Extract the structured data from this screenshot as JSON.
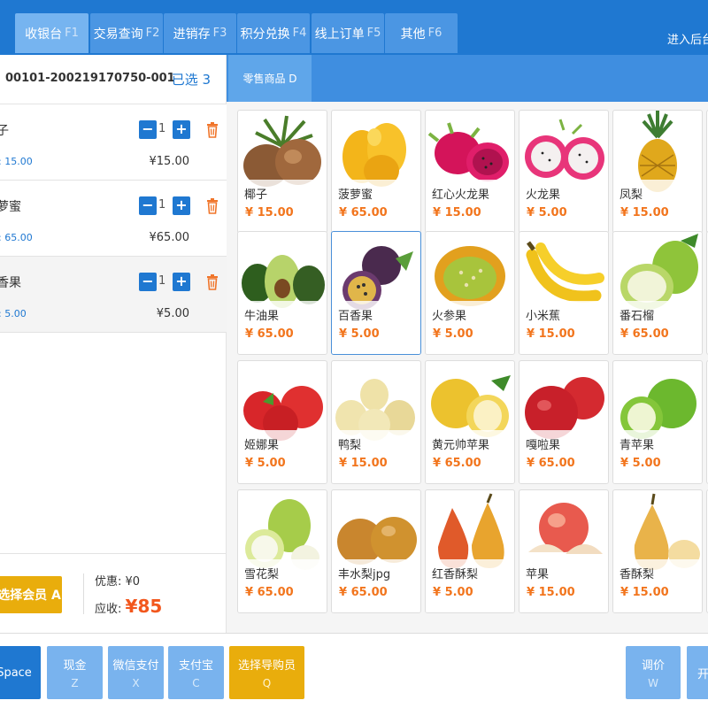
{
  "colors": {
    "primary": "#1f78d1",
    "accent_orange": "#f2571d",
    "yellow_button": "#e9ad0c"
  },
  "nav": {
    "tabs": [
      {
        "label": "收银台",
        "key": "F1"
      },
      {
        "label": "交易查询",
        "key": "F2"
      },
      {
        "label": "进销存",
        "key": "F3"
      },
      {
        "label": "积分兑换",
        "key": "F4"
      },
      {
        "label": "线上订单",
        "key": "F5"
      },
      {
        "label": "其他",
        "key": "F6"
      }
    ],
    "enter_back": "进入后台"
  },
  "order": {
    "number": "00101-200219170750-001",
    "selected": "已选 3",
    "items": [
      {
        "name": "子",
        "unit_price": ": 15.00",
        "qty": "1",
        "total": "¥15.00"
      },
      {
        "name": "萝蜜",
        "unit_price": ": 65.00",
        "qty": "1",
        "total": "¥65.00"
      },
      {
        "name": "香果",
        "unit_price": ": 5.00",
        "qty": "1",
        "total": "¥5.00"
      }
    ],
    "member_button": "选择会员 A",
    "discount": "优惠: ¥0",
    "receivable_label": "应收:",
    "receivable_amount": "¥85"
  },
  "category": {
    "label": "零售商品 D"
  },
  "products": [
    {
      "name": "椰子",
      "price": "¥ 15.00"
    },
    {
      "name": "菠萝蜜",
      "price": "¥ 65.00"
    },
    {
      "name": "红心火龙果",
      "price": "¥ 15.00"
    },
    {
      "name": "火龙果",
      "price": "¥ 5.00"
    },
    {
      "name": "凤梨",
      "price": "¥ 15.00"
    },
    {
      "name": "牛油果",
      "price": "¥ 65.00"
    },
    {
      "name": "百香果",
      "price": "¥ 5.00"
    },
    {
      "name": "火参果",
      "price": "¥ 5.00"
    },
    {
      "name": "小米蕉",
      "price": "¥ 15.00"
    },
    {
      "name": "番石榴",
      "price": "¥ 65.00"
    },
    {
      "name": "姬娜果",
      "price": "¥ 5.00"
    },
    {
      "name": "鸭梨",
      "price": "¥ 15.00"
    },
    {
      "name": "黄元帅苹果",
      "price": "¥ 65.00"
    },
    {
      "name": "嘎啦果",
      "price": "¥ 65.00"
    },
    {
      "name": "青苹果",
      "price": "¥ 5.00"
    },
    {
      "name": "雪花梨",
      "price": "¥ 65.00"
    },
    {
      "name": "丰水梨jpg",
      "price": "¥ 65.00"
    },
    {
      "name": "红香酥梨",
      "price": "¥ 5.00"
    },
    {
      "name": "苹果",
      "price": "¥ 15.00"
    },
    {
      "name": "香酥梨",
      "price": "¥ 15.00"
    }
  ],
  "actions": {
    "space": {
      "label": "Space"
    },
    "cash": {
      "label": "现金",
      "key": "Z"
    },
    "wechat": {
      "label": "微信支付",
      "key": "X"
    },
    "alipay": {
      "label": "支付宝",
      "key": "C"
    },
    "guide": {
      "label": "选择导购员",
      "key": "Q"
    },
    "adjust": {
      "label": "调价",
      "key": "W"
    },
    "more": {
      "label": "开"
    }
  }
}
